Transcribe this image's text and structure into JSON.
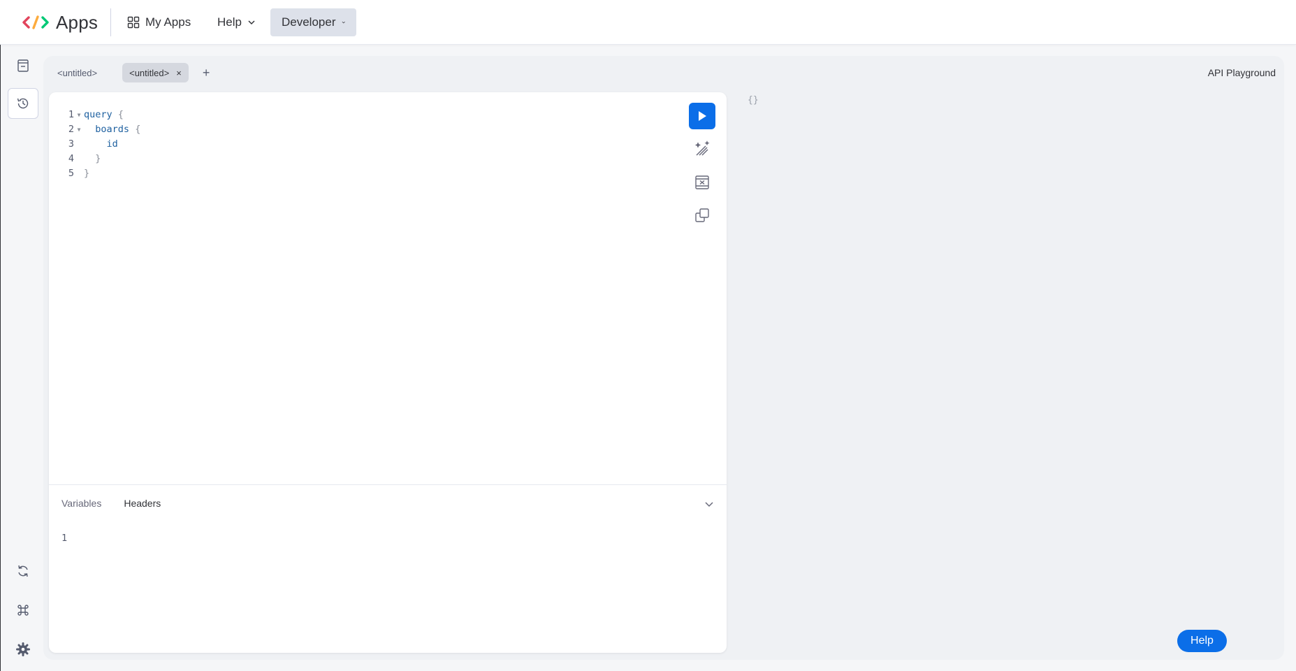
{
  "app": {
    "logo_text": "Apps"
  },
  "nav": {
    "my_apps": "My Apps",
    "help": "Help",
    "developer": "Developer"
  },
  "tabs": [
    {
      "label": "<untitled>",
      "active": false
    },
    {
      "label": "<untitled>",
      "active": true
    }
  ],
  "tab_close": "×",
  "tab_add": "+",
  "page_title": "API Playground",
  "editor": {
    "lines": [
      {
        "num": "1",
        "text": "query {"
      },
      {
        "num": "2",
        "text": "  boards {"
      },
      {
        "num": "3",
        "text": "    id"
      },
      {
        "num": "4",
        "text": "  }"
      },
      {
        "num": "5",
        "text": "}"
      }
    ]
  },
  "bottom_panel": {
    "tabs": [
      "Variables",
      "Headers"
    ],
    "active_tab": "Headers",
    "line_num": "1"
  },
  "result_placeholder": "{}",
  "help_button": "Help",
  "colors": {
    "accent": "#0b6ee8",
    "keyword": "#1f61a0",
    "selected_nav": "#dde1ea"
  },
  "icons": {
    "rail": [
      "documents-icon",
      "history-icon",
      "refresh-icon",
      "command-icon",
      "settings-icon"
    ],
    "toolbar": [
      "play-icon",
      "prettify-icon",
      "merge-icon",
      "copy-icon"
    ]
  }
}
